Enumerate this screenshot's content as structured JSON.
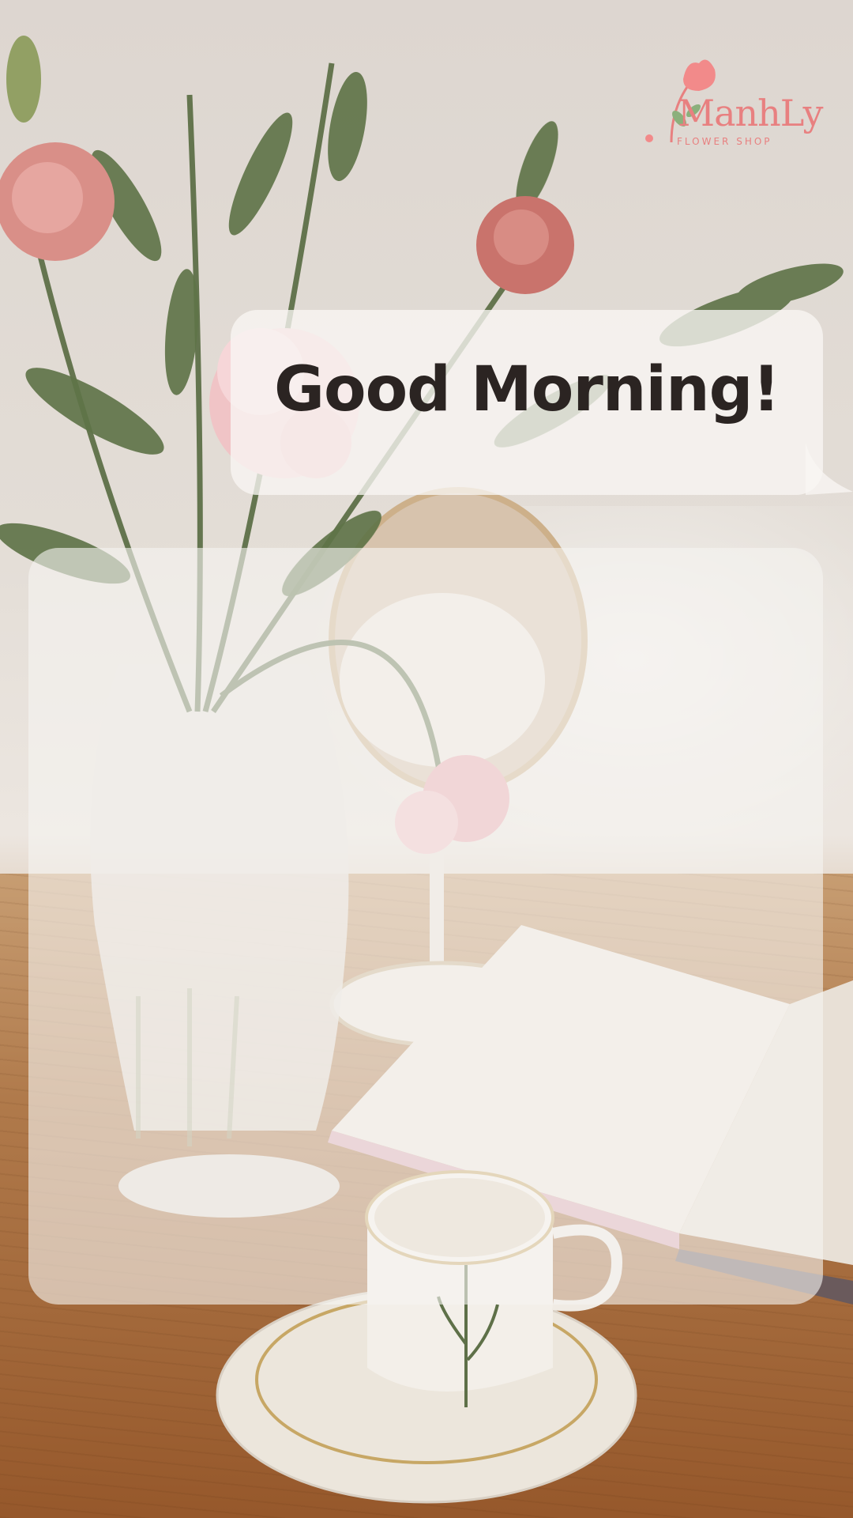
{
  "brand": {
    "name": "ManhLy",
    "tagline": "FLOWER SHOP",
    "logo_icon": "flower-icon",
    "color": "#e88080"
  },
  "greeting": {
    "text": "Good Morning!",
    "color": "#2b2422"
  },
  "colors": {
    "panel_bg": "rgba(245,243,240,0.62)",
    "bubble_bg": "rgba(248,246,243,0.78)"
  }
}
